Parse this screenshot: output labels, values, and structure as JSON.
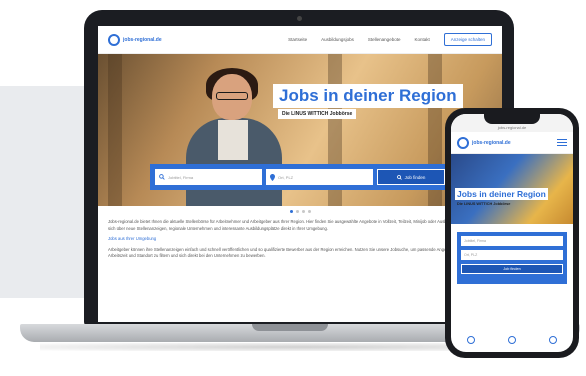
{
  "site": {
    "logo_text": "jobs-regional.de",
    "nav": [
      "Startseite",
      "Ausbildungsjobs",
      "Stellenangebote",
      "Kontakt"
    ],
    "cta": "Anzeige schalten"
  },
  "hero": {
    "headline": "Jobs in deiner Region",
    "subline": "Die LINUS WITTICH Jobbörse",
    "search": {
      "what_placeholder": "Jobtitel, Firma",
      "where_placeholder": "Ort, PLZ",
      "button": "Job finden"
    }
  },
  "carousel": {
    "count": 4,
    "active": 0
  },
  "body_text": [
    "Jobs-regional.de bietet Ihnen die aktuelle Stellenbörse für Arbeitnehmer und Arbeitgeber aus Ihrer Region. Hier finden Sie ausgewählte Angebote in Vollzeit, Teilzeit, Minijob oder Ausbildung. Informieren Sie sich über neue Stellenanzeigen, regionale Unternehmen und interessante Ausbildungsplätze direkt in Ihrer Umgebung.",
    "Arbeitgeber können ihre Stellenanzeigen einfach und schnell veröffentlichen und so qualifizierte Bewerber aus der Region erreichen. Nutzen Sie unsere Jobsuche, um passende Angebote nach Berufsfeld, Arbeitszeit und Standort zu filtern und sich direkt bei den Unternehmen zu bewerben."
  ],
  "body_link": "Jobs aus Ihrer Umgebung",
  "phone": {
    "url": "jobs-regional.de",
    "headline": "Jobs in deiner Region",
    "sub": "Die LINUS WITTICH Jobbörse",
    "what_placeholder": "Jobtitel, Firma",
    "where_placeholder": "Ort, PLZ",
    "button": "Job finden"
  },
  "colors": {
    "brand": "#2f6fd6",
    "brand_dark": "#1d56b5"
  }
}
